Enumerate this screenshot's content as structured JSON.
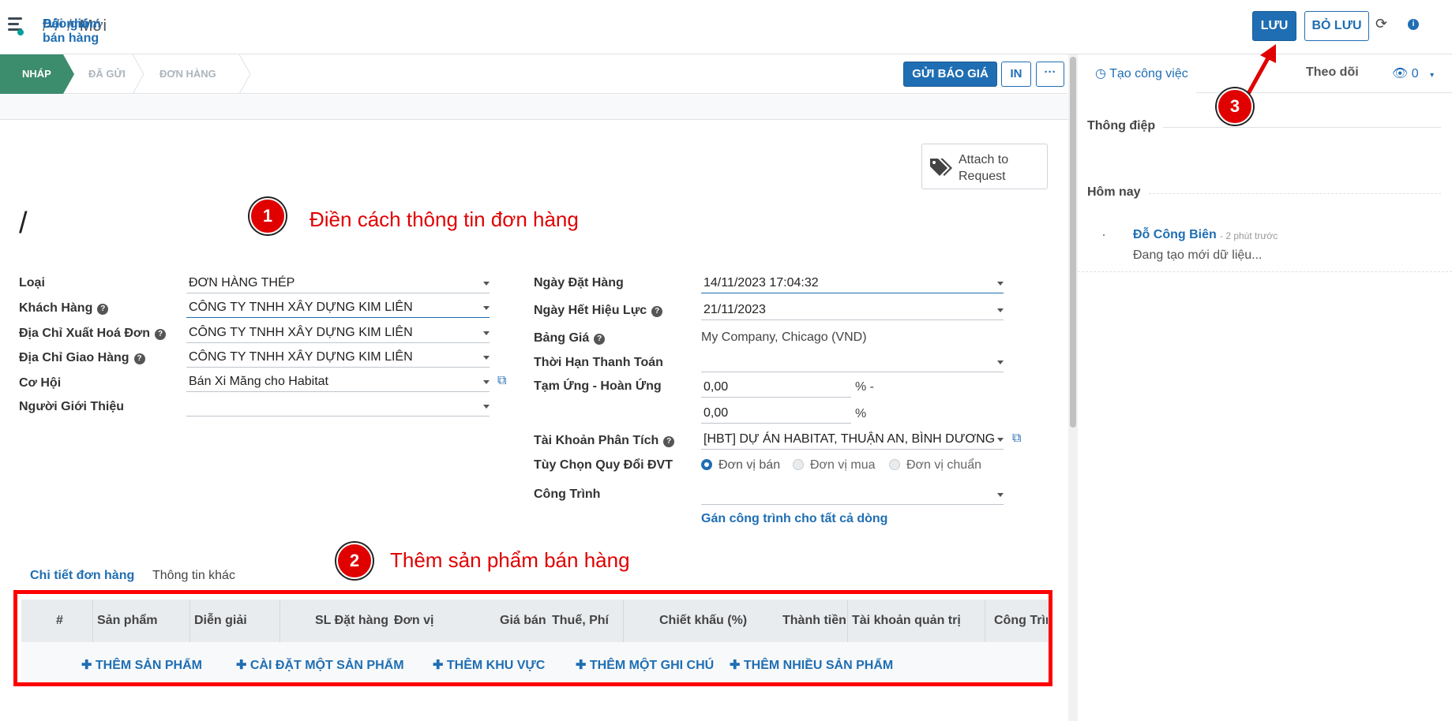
{
  "topbar": {
    "breadcrumb": [
      "Đội nhóm bán hàng",
      "...",
      "Báo giá",
      "Mới"
    ],
    "save_label": "LƯU",
    "discard_label": "BỎ LƯU"
  },
  "status": {
    "stages": [
      "NHÁP",
      "ĐÃ GỬI",
      "ĐƠN HÀNG"
    ],
    "send_label": "GỬI BÁO GIÁ",
    "print_label": "IN",
    "more_label": "···"
  },
  "attach": {
    "label_line1": "Attach to",
    "label_line2": "Request"
  },
  "title_value": "/",
  "annotations": {
    "step1_num": "1",
    "step1_text": "Điền cách thông tin đơn hàng",
    "step2_num": "2",
    "step2_text": "Thêm sản phẩm bán hàng",
    "step3_num": "3"
  },
  "left_fields": [
    {
      "label": "Loại",
      "value": "ĐƠN HÀNG THÉP"
    },
    {
      "label": "Khách Hàng",
      "value": "CÔNG TY TNHH XÂY DỰNG KIM LIÊN"
    },
    {
      "label": "Địa Chỉ Xuất Hoá Đơn",
      "value": "CÔNG TY TNHH XÂY DỰNG KIM LIÊN"
    },
    {
      "label": "Địa Chỉ Giao Hàng",
      "value": "CÔNG TY TNHH XÂY DỰNG KIM LIÊN"
    },
    {
      "label": "Cơ Hội",
      "value": "Bán Xi Măng cho Habitat"
    },
    {
      "label": "Người Giới Thiệu",
      "value": ""
    }
  ],
  "right_fields": {
    "order_date_label": "Ngày Đặt Hàng",
    "order_date_value": "14/11/2023 17:04:32",
    "expiry_label": "Ngày Hết Hiệu Lực",
    "expiry_value": "21/11/2023",
    "pricelist_label": "Bảng Giá",
    "pricelist_value": "My Company, Chicago (VND)",
    "payment_term_label": "Thời Hạn Thanh Toán",
    "payment_term_value": "",
    "advance_label": "Tạm Ứng - Hoàn Ứng",
    "advance_value1": "0,00",
    "advance_unit1": "% -",
    "advance_value2": "0,00",
    "advance_unit2": "%",
    "analytic_label": "Tài Khoản Phân Tích",
    "analytic_value": "[HBT] DỰ ÁN HABITAT, THUẬN AN, BÌNH DƯƠNG",
    "uom_label": "Tùy Chọn Quy Đổi ĐVT",
    "uom_options": [
      "Đơn vị bán",
      "Đơn vị mua",
      "Đơn vị chuẩn"
    ],
    "uom_selected": "Đơn vị bán",
    "project_label": "Công Trình",
    "project_value": "",
    "assign_link": "Gán công trình cho tất cả dòng"
  },
  "tabs": [
    "Chi tiết đơn hàng",
    "Thông tin khác"
  ],
  "table": {
    "columns": [
      "#",
      "Sản phẩm",
      "Diễn giải",
      "SL Đặt hàng",
      "Đơn vị",
      "Giá bán",
      "Thuế, Phí",
      "Chiết khấu (%)",
      "Thành tiền",
      "Tài khoản quản trị",
      "Công Trìn"
    ],
    "add_links": [
      "THÊM SẢN PHẨM",
      "CÀI ĐẶT MỘT SẢN PHẨM",
      "THÊM KHU VỰC",
      "THÊM MỘT GHI CHÚ",
      "THÊM NHIỀU SẢN PHẨM"
    ]
  },
  "chatter": {
    "activity_label": "Tạo công việc",
    "follow_label": "Theo dõi",
    "followers_count": "0",
    "message_label": "Thông điệp",
    "today_label": "Hôm nay",
    "author": "Đỗ Công Biên",
    "time": "- 2 phút trước",
    "message": "Đang tạo mới dữ liệu..."
  },
  "colors": {
    "primary": "#1f6eb3",
    "stage_active": "#3c8c6e",
    "annotation": "#e00000"
  }
}
